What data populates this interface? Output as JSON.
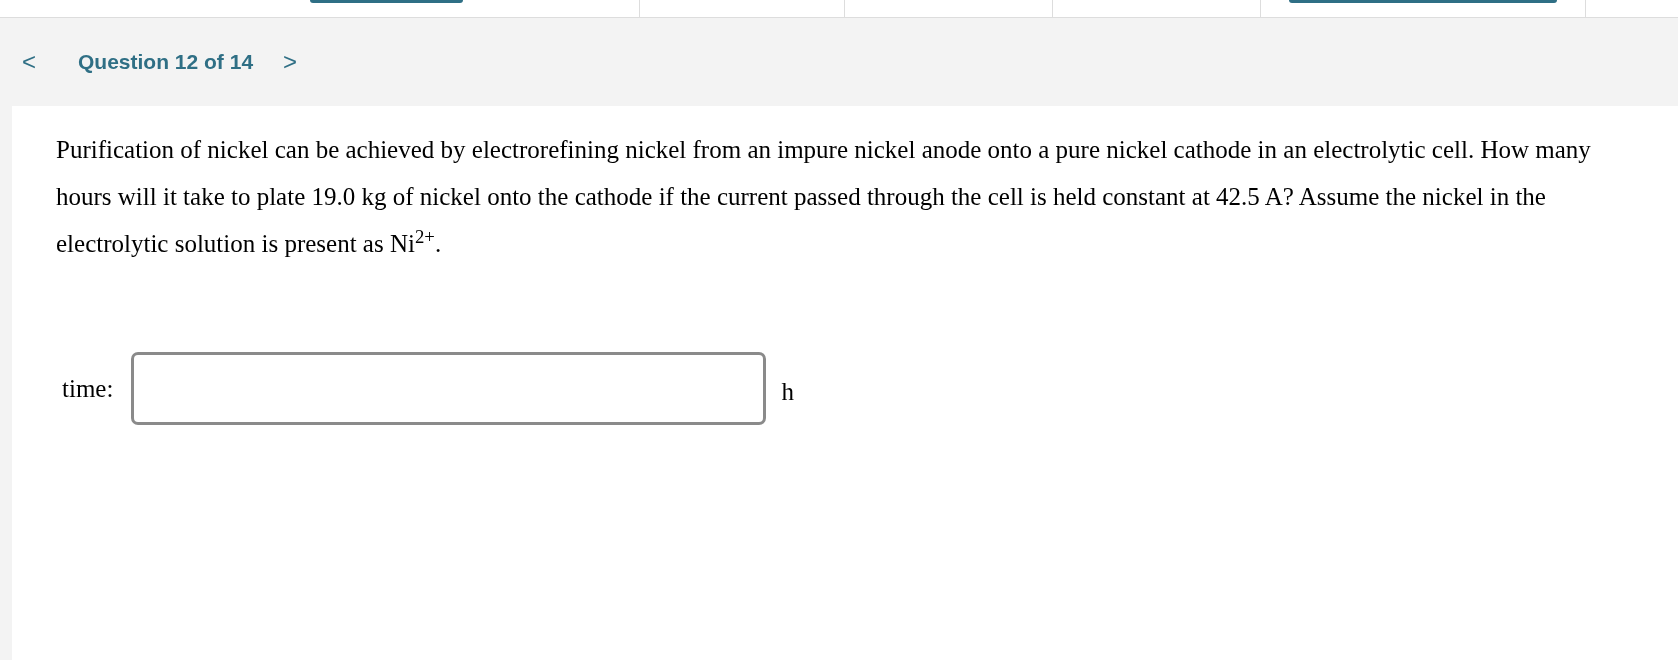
{
  "navigation": {
    "prev_icon": "<",
    "title": "Question 12 of 14",
    "next_icon": ">"
  },
  "question": {
    "text": "Purification of nickel can be achieved by electrorefining nickel from an impure nickel anode onto a pure nickel cathode in an electrolytic cell. How many hours will it take to plate 19.0 kg of nickel onto the cathode if the current passed through the cell is held constant at 42.5 A? Assume the nickel in the electrolytic solution is present as Ni$^{2+}$."
  },
  "answer": {
    "label": "time:",
    "unit": "h"
  }
}
